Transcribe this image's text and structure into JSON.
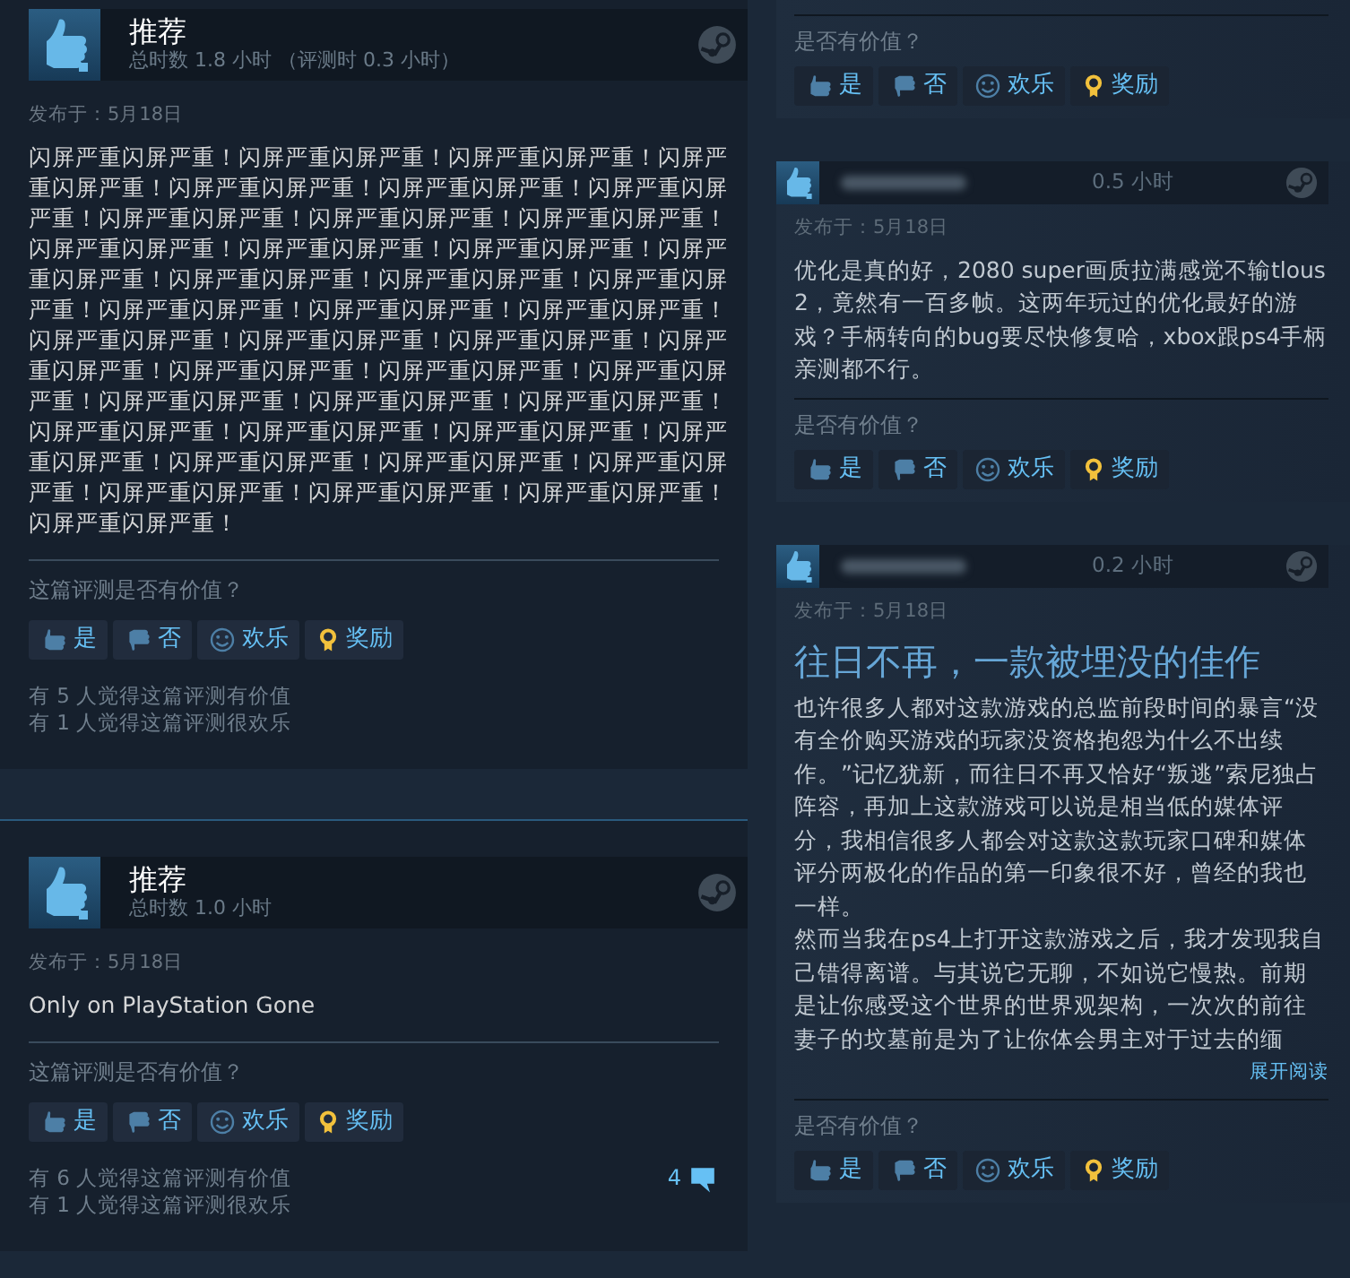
{
  "left_column": [
    {
      "kind": "full",
      "recommendation": "推荐",
      "hours": "总时数 1.8 小时 （评测时 0.3 小时）",
      "posted": "发布于：5月18日",
      "body": [
        "闪屏严重闪屏严重！闪屏严重闪屏严重！闪屏严重闪屏严重！闪屏严重闪屏严重！闪屏严重闪屏严重！闪屏严重闪屏严重！闪屏严重闪屏严重！闪屏严重闪屏严重！闪屏严重闪屏严重！闪屏严重闪屏严重！闪屏严重闪屏严重！闪屏严重闪屏严重！闪屏严重闪屏严重！闪屏严重闪屏严重！闪屏严重闪屏严重！闪屏严重闪屏严重！闪屏严重闪屏严重！闪屏严重闪屏严重！闪屏严重闪屏严重！闪屏严重闪屏严重！闪屏严重闪屏严重！闪屏严重闪屏严重！闪屏严重闪屏严重！闪屏严重闪屏严重！闪屏严重闪屏严重！闪屏严重闪屏严重！闪屏严重闪屏严重！闪屏严重闪屏严重！闪屏严重闪屏严重！闪屏严重闪屏严重！闪屏严重闪屏严重！闪屏严重闪屏严重！闪屏严重闪屏严重！闪屏严重闪屏严重！闪屏严重闪屏严重！闪屏严重闪屏严重！闪屏严重闪屏严重！闪屏严重闪屏严重！闪屏严重闪屏严重！闪屏严重闪屏严重！闪屏严重闪屏严重！"
      ],
      "question": "这篇评测是否有价值？",
      "buttons": [
        {
          "kind": "yes",
          "label": "是"
        },
        {
          "kind": "no",
          "label": "否"
        },
        {
          "kind": "funny",
          "label": "欢乐"
        },
        {
          "kind": "award",
          "label": "奖励"
        }
      ],
      "stats": [
        "有 5 人觉得这篇评测有价值",
        "有 1 人觉得这篇评测很欢乐"
      ]
    },
    {
      "kind": "full",
      "recommendation": "推荐",
      "hours": "总时数 1.0 小时",
      "posted": "发布于：5月18日",
      "body": [
        "Only on PlayStation Gone"
      ],
      "question": "这篇评测是否有价值？",
      "buttons": [
        {
          "kind": "yes",
          "label": "是"
        },
        {
          "kind": "no",
          "label": "否"
        },
        {
          "kind": "funny",
          "label": "欢乐"
        },
        {
          "kind": "award",
          "label": "奖励"
        }
      ],
      "stats": [
        "有 6 人觉得这篇评测有价值",
        "有 1 人觉得这篇评测很欢乐"
      ],
      "comments": "4"
    }
  ],
  "right_column": [
    {
      "kind": "tail",
      "question": "是否有价值？",
      "buttons": [
        {
          "kind": "yes",
          "label": "是"
        },
        {
          "kind": "no",
          "label": "否"
        },
        {
          "kind": "funny",
          "label": "欢乐"
        },
        {
          "kind": "award",
          "label": "奖励"
        }
      ]
    },
    {
      "kind": "compact",
      "hours": "0.5 小时",
      "posted": "发布于：5月18日",
      "body": [
        "优化是真的好，2080 super画质拉满感觉不输tlous2，竟然有一百多帧。这两年玩过的优化最好的游戏？手柄转向的bug要尽快修复哈，xbox跟ps4手柄亲测都不行。"
      ],
      "question": "是否有价值？",
      "buttons": [
        {
          "kind": "yes",
          "label": "是"
        },
        {
          "kind": "no",
          "label": "否"
        },
        {
          "kind": "funny",
          "label": "欢乐"
        },
        {
          "kind": "award",
          "label": "奖励"
        }
      ]
    },
    {
      "kind": "compact",
      "hours": "0.2 小时",
      "posted": "发布于：5月18日",
      "title": "往日不再，一款被埋没的佳作",
      "body": [
        "也许很多人都对这款游戏的总监前段时间的暴言“没有全价购买游戏的玩家没资格抱怨为什么不出续作。”记忆犹新，而往日不再又恰好“叛逃”索尼独占阵容，再加上这款游戏可以说是相当低的媒体评分，我相信很多人都会对这款这款玩家口碑和媒体评分两极化的作品的第一印象很不好，曾经的我也一样。",
        "然而当我在ps4上打开这款游戏之后，我才发现我自己错得离谱。与其说它无聊，不如说它慢热。前期是让你感受这个世界的世界观架构，一次次的前往妻子的坟墓前是为了让你体会男主对于过去的缅"
      ],
      "expand": "展开阅读",
      "question": "是否有价值？",
      "buttons": [
        {
          "kind": "yes",
          "label": "是"
        },
        {
          "kind": "no",
          "label": "否"
        },
        {
          "kind": "funny",
          "label": "欢乐"
        },
        {
          "kind": "award",
          "label": "奖励"
        }
      ]
    }
  ]
}
